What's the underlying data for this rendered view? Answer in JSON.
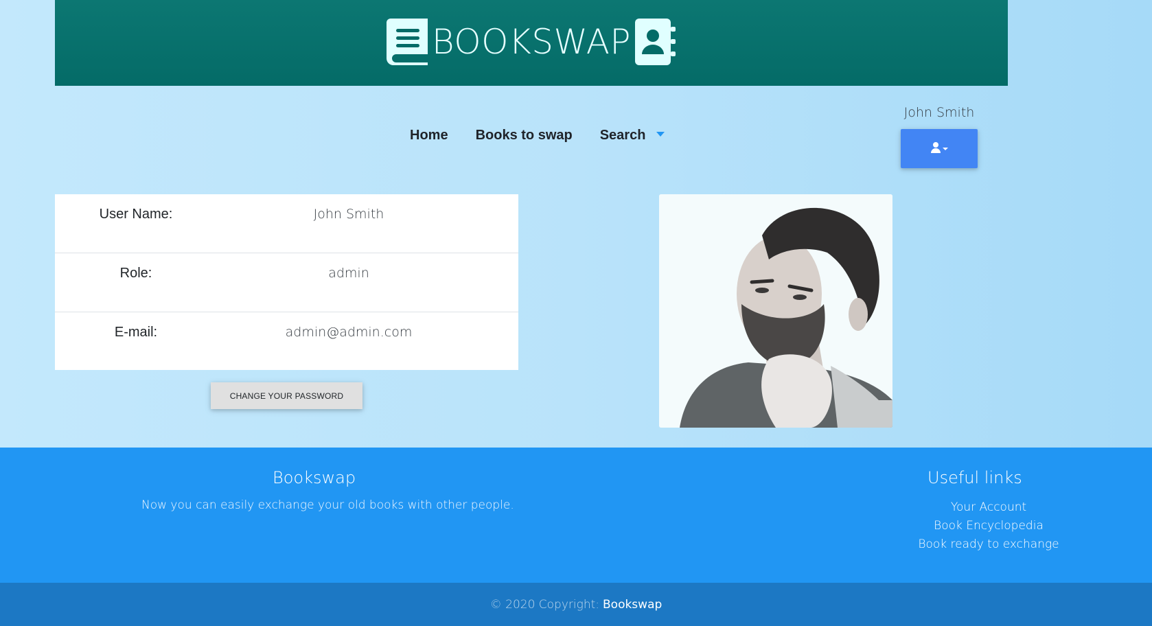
{
  "header": {
    "brand": "BOOKSWAP",
    "left_icon": "book-icon",
    "right_icon": "address-book-icon"
  },
  "nav": {
    "items": [
      {
        "label": "Home"
      },
      {
        "label": "Books to swap"
      },
      {
        "label": "Search"
      }
    ]
  },
  "user": {
    "name": "John Smith",
    "menu_icon": "user-icon"
  },
  "profile": {
    "rows": [
      {
        "label": "User Name:",
        "value": "John Smith"
      },
      {
        "label": "Role:",
        "value": "admin"
      },
      {
        "label": "E-mail:",
        "value": "admin@admin.com"
      }
    ],
    "change_password": "CHANGE YOUR PASSWORD"
  },
  "footer": {
    "title": "Bookswap",
    "description": "Now you can easily exchange your old books with other people.",
    "links_title": "Useful links",
    "links": [
      {
        "label": "Your Account"
      },
      {
        "label": "Book Encyclopedia"
      },
      {
        "label": "Book ready to exchange"
      }
    ],
    "copyright": "© 2020 Copyright:",
    "copyright_link": "Bookswap"
  },
  "colors": {
    "banner": "#046b67",
    "accent_blue": "#4285f4",
    "footer": "#2196f3",
    "copyright_bar": "#1c78c4"
  }
}
